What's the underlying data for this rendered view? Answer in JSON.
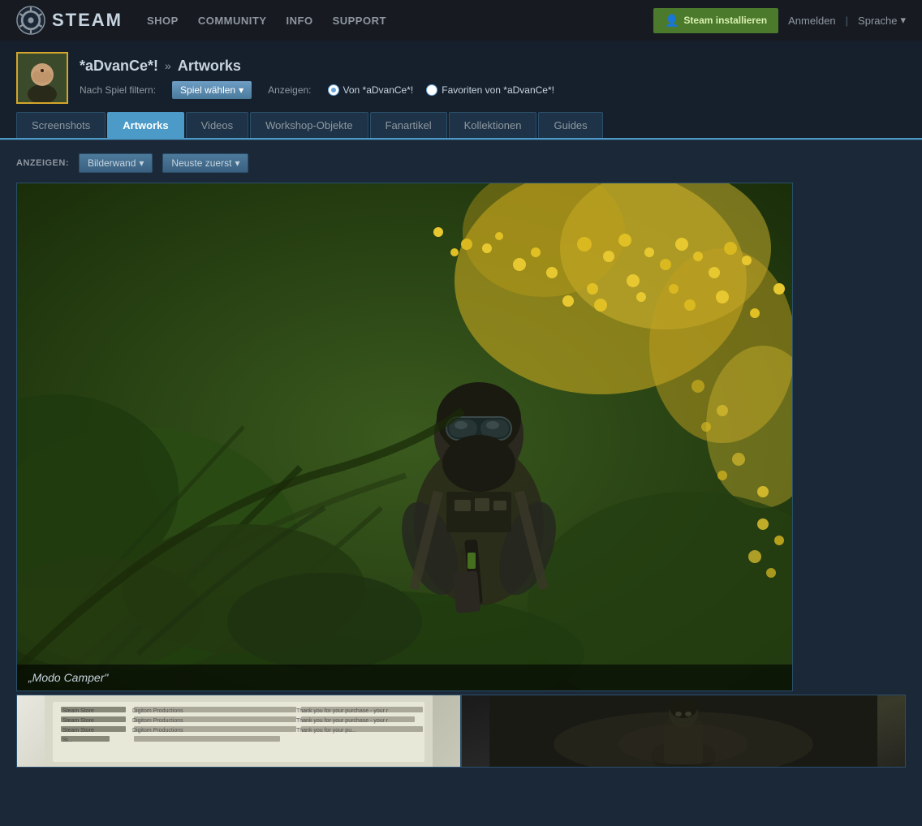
{
  "topbar": {
    "logo_text": "STEAM",
    "nav": {
      "shop": "SHOP",
      "community": "COMMUNITY",
      "info": "INFO",
      "support": "SUPPORT"
    },
    "install_button": "Steam installieren",
    "login_link": "Anmelden",
    "separator": "|",
    "language_btn": "Sprache"
  },
  "profile": {
    "username": "*aDvanCe*!",
    "breadcrumb_separator": "»",
    "page_title": "Artworks",
    "filter_label": "Nach Spiel filtern:",
    "filter_btn": "Spiel wählen",
    "anzeigen_label": "Anzeigen:",
    "radio_own": "Von *aDvanCe*!",
    "radio_fav": "Favoriten von *aDvanCe*!"
  },
  "tabs": [
    {
      "id": "screenshots",
      "label": "Screenshots",
      "active": false
    },
    {
      "id": "artworks",
      "label": "Artworks",
      "active": true
    },
    {
      "id": "videos",
      "label": "Videos",
      "active": false
    },
    {
      "id": "workshop",
      "label": "Workshop-Objekte",
      "active": false
    },
    {
      "id": "fanartikel",
      "label": "Fanartikel",
      "active": false
    },
    {
      "id": "kollektionen",
      "label": "Kollektionen",
      "active": false
    },
    {
      "id": "guides",
      "label": "Guides",
      "active": false
    }
  ],
  "display_controls": {
    "label": "ANZEIGEN:",
    "view_btn": "Bilderwand",
    "sort_btn": "Neuste zuerst"
  },
  "main_artwork": {
    "caption": "„Modo Camper\""
  },
  "thumbnails": [
    {
      "id": "thumb-receipt",
      "doc_labels": [
        "Steam Store",
        "Steam Store",
        "Steam Store",
        "St..."
      ],
      "doc_company": "Digitom Productions",
      "doc_text": "Thank you for your purchase - your r"
    },
    {
      "id": "thumb-character",
      "desc": "Dark character thumbnail"
    }
  ],
  "colors": {
    "accent_blue": "#4b9ac7",
    "bg_dark": "#1b2838",
    "bg_darker": "#171a21",
    "border": "#2a4f6b",
    "text_muted": "#8f98a0",
    "text_main": "#c6d4df",
    "install_green": "#4c7a2c"
  }
}
